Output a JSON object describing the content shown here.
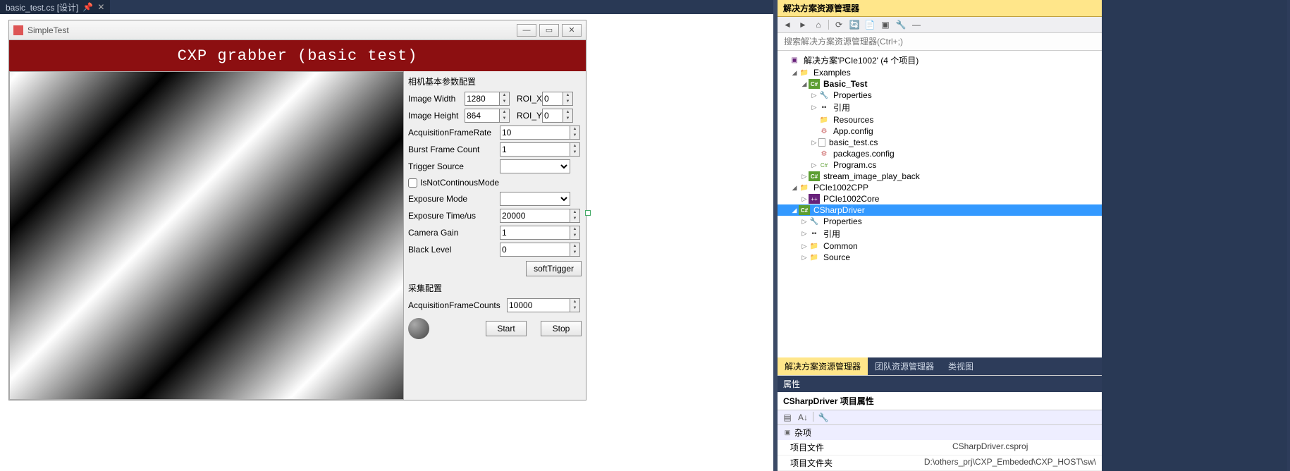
{
  "tab": {
    "label": "basic_test.cs [设计]"
  },
  "form": {
    "title": "SimpleTest",
    "banner": "CXP grabber (basic test)"
  },
  "camera_group": {
    "title": "相机基本参数配置",
    "image_width_label": "Image Width",
    "image_width": "1280",
    "roi_x_label": "ROI_X",
    "roi_x": "0",
    "image_height_label": "Image Height",
    "image_height": "864",
    "roi_y_label": "ROI_Y",
    "roi_y": "0",
    "frame_rate_label": "AcquisitionFrameRate",
    "frame_rate": "10",
    "burst_label": "Burst Frame Count",
    "burst": "1",
    "trigger_src_label": "Trigger Source",
    "trigger_src": "",
    "not_continous_label": "IsNotContinousMode",
    "exposure_mode_label": "Exposure Mode",
    "exposure_mode": "",
    "exposure_time_label": "Exposure Time/us",
    "exposure_time": "20000",
    "gain_label": "Camera Gain",
    "gain": "1",
    "black_level_label": "Black Level",
    "black_level": "0",
    "soft_trigger": "softTrigger"
  },
  "acq_group": {
    "title": "采集配置",
    "frame_counts_label": "AcquisitionFrameCounts",
    "frame_counts": "10000",
    "start": "Start",
    "stop": "Stop"
  },
  "explorer": {
    "header": "解决方案资源管理器",
    "search_placeholder": "搜索解决方案资源管理器(Ctrl+;)",
    "solution": "解决方案'PCIe1002' (4 个项目)",
    "nodes": {
      "examples": "Examples",
      "basic_test": "Basic_Test",
      "properties": "Properties",
      "references": "引用",
      "resources": "Resources",
      "app_config": "App.config",
      "basic_test_cs": "basic_test.cs",
      "packages_config": "packages.config",
      "program_cs": "Program.cs",
      "stream_playback": "stream_image_play_back",
      "pcie1002cpp": "PCIe1002CPP",
      "pcie1002core": "PCIe1002Core",
      "csharpdriver": "CSharpDriver",
      "common": "Common",
      "source": "Source"
    },
    "bottom_tabs": {
      "sol": "解决方案资源管理器",
      "team": "团队资源管理器",
      "classview": "类视图"
    }
  },
  "props": {
    "header": "属性",
    "title": "CSharpDriver 项目属性",
    "category": "杂项",
    "rows": [
      {
        "k": "项目文件",
        "v": "CSharpDriver.csproj"
      },
      {
        "k": "项目文件夹",
        "v": "D:\\others_prj\\CXP_Embeded\\CXP_HOST\\sw\\"
      }
    ]
  }
}
